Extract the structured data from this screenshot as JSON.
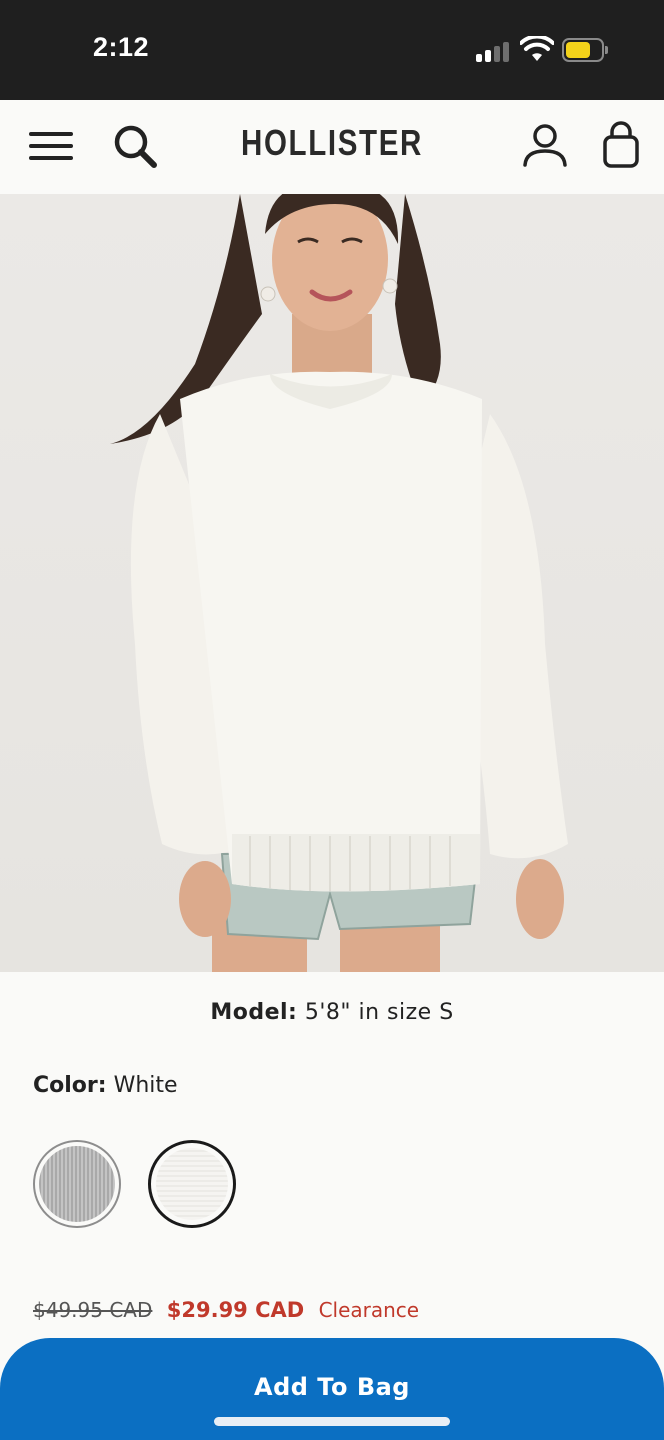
{
  "status_bar": {
    "time": "2:12",
    "battery_color": "#f3d21a"
  },
  "header": {
    "brand": "HOLLISTER",
    "icons": [
      "menu-icon",
      "search-icon",
      "account-icon",
      "bag-icon"
    ]
  },
  "product": {
    "image_alt": "White oversized crew-neck sweater",
    "model_label": "Model:",
    "model_value": "5'8\" in size S",
    "color_label": "Color:",
    "color_value": "White",
    "swatches": [
      {
        "name": "Grey",
        "selected": false
      },
      {
        "name": "White",
        "selected": true
      }
    ],
    "price_original": "$49.95 CAD",
    "price_sale": "$29.99 CAD",
    "price_tag": "Clearance",
    "accent_color": "#c0392b"
  },
  "actions": {
    "add_to_bag": "Add To Bag",
    "button_color": "#0b6fc2"
  }
}
